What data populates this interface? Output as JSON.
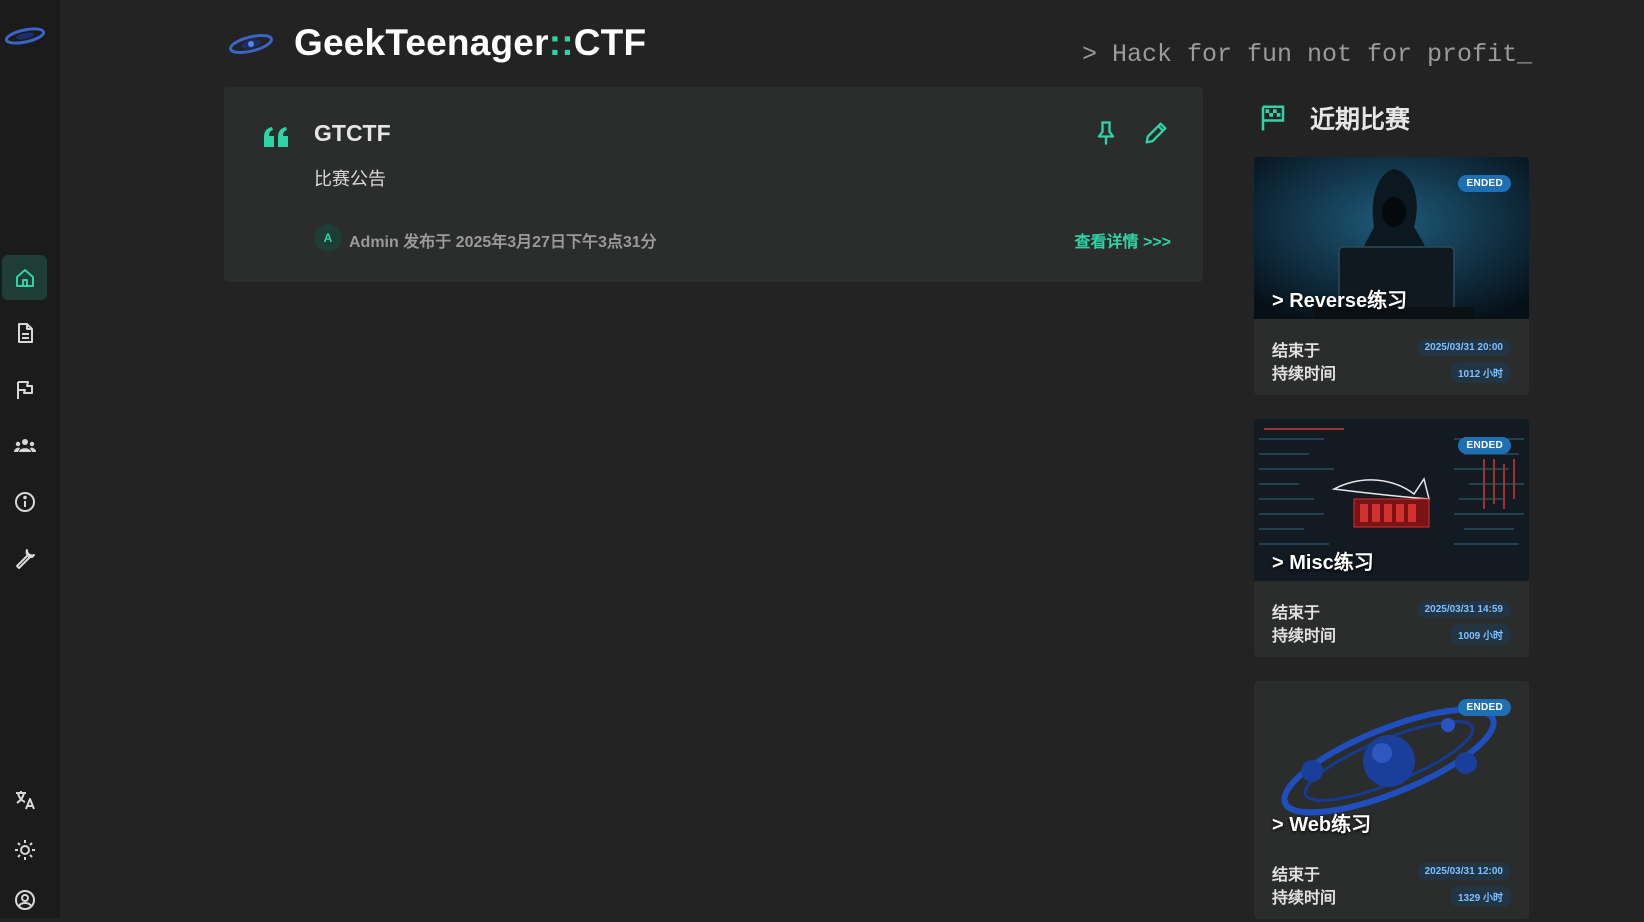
{
  "brand": {
    "title_main": "GeekTeenager",
    "title_sep": "::",
    "title_suffix": "CTF",
    "tagline": "> Hack for fun not for profit_"
  },
  "sidebar": {
    "items": [
      {
        "name": "home",
        "icon": "home-icon",
        "active": true
      },
      {
        "name": "posts",
        "icon": "document-icon",
        "active": false
      },
      {
        "name": "games",
        "icon": "flag-icon",
        "active": false
      },
      {
        "name": "teams",
        "icon": "people-icon",
        "active": false
      },
      {
        "name": "about",
        "icon": "info-icon",
        "active": false
      },
      {
        "name": "admin",
        "icon": "wrench-icon",
        "active": false
      }
    ],
    "bottom": [
      {
        "name": "language",
        "icon": "translate-icon"
      },
      {
        "name": "theme",
        "icon": "brightness-icon"
      },
      {
        "name": "account",
        "icon": "account-icon"
      }
    ]
  },
  "announcement": {
    "title": "GTCTF",
    "subtitle": "比赛公告",
    "avatar_letter": "A",
    "meta": "Admin 发布于 2025年3月27日下午3点31分",
    "link": "查看详情 >>>"
  },
  "recent": {
    "title": "近期比赛",
    "games": [
      {
        "name": "> Reverse练习",
        "badge": "ENDED",
        "end_label": "结束于",
        "end_time": "2025/03/31 20:00",
        "duration_label": "持续时间",
        "duration": "1012 小时"
      },
      {
        "name": "> Misc练习",
        "badge": "ENDED",
        "end_label": "结束于",
        "end_time": "2025/03/31 14:59",
        "duration_label": "持续时间",
        "duration": "1009 小时"
      },
      {
        "name": "> Web练习",
        "badge": "ENDED",
        "end_label": "结束于",
        "end_time": "2025/03/31 12:00",
        "duration_label": "持续时间",
        "duration": "1329 小时"
      }
    ]
  },
  "colors": {
    "accent": "#2fd4a6",
    "background": "#232323",
    "sidebar": "#1b1b1b",
    "card": "#2b2c2c",
    "badge": "#1f6fb5"
  }
}
